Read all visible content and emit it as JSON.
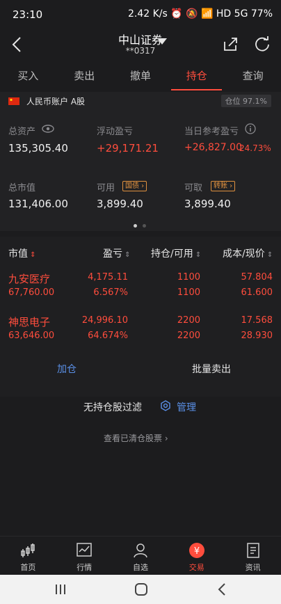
{
  "status_bar": {
    "time": "23:10",
    "right": "2.42 K/s  ⏰ 🔕 📶 HD 5G  77%"
  },
  "header": {
    "broker": "中山证券",
    "account_mask": "**0317"
  },
  "tabs": [
    "买入",
    "卖出",
    "撤单",
    "持仓",
    "查询"
  ],
  "account": {
    "label": "人民币账户 A股",
    "position_ratio": "仓位 97.1%"
  },
  "summary": {
    "total_assets_label": "总资产",
    "total_assets": "135,305.40",
    "float_pl_label": "浮动盈亏",
    "float_pl": "+29,171.21",
    "day_pl_label": "当日参考盈亏",
    "day_pl": "+26,827.00",
    "day_pl_pct": "24.73%",
    "market_value_label": "总市值",
    "market_value": "131,406.00",
    "available_label": "可用",
    "available_tag": "国债",
    "available": "3,899.40",
    "withdrawable_label": "可取",
    "withdrawable_tag": "转账",
    "withdrawable": "3,899.40"
  },
  "table": {
    "headers": [
      "市值",
      "盈亏",
      "持仓/可用",
      "成本/现价"
    ],
    "rows": [
      {
        "name": "九安医疗",
        "market_value": "67,760.00",
        "pl": "4,175.11",
        "pl_pct": "6.567%",
        "hold": "1100",
        "avail": "1100",
        "cost": "57.804",
        "price": "61.600"
      },
      {
        "name": "神思电子",
        "market_value": "63,646.00",
        "pl": "24,996.10",
        "pl_pct": "64.674%",
        "hold": "2200",
        "avail": "2200",
        "cost": "17.568",
        "price": "28.930"
      }
    ],
    "add_label": "加仓",
    "batch_sell_label": "批量卖出"
  },
  "filter": {
    "text": "无持仓股过滤",
    "manage": "管理",
    "cleared_link": "查看已清仓股票"
  },
  "bottom_nav": [
    "首页",
    "行情",
    "自选",
    "交易",
    "资讯"
  ],
  "colors": {
    "accent": "#ff4d3d",
    "background": "#1c1c1e"
  }
}
